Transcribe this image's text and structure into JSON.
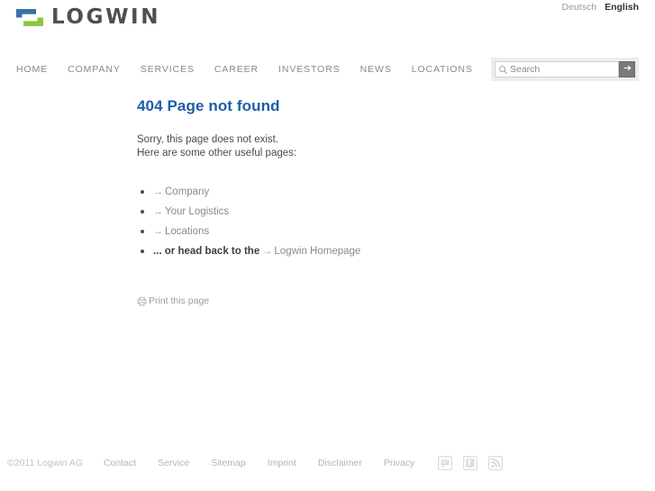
{
  "header": {
    "logo_text": "LOGWIN",
    "logo_icon": "logwin-logo-mark",
    "languages": [
      {
        "label": "Deutsch",
        "active": false
      },
      {
        "label": "English",
        "active": true
      }
    ]
  },
  "nav": {
    "items": [
      {
        "label": "HOME"
      },
      {
        "label": "COMPANY"
      },
      {
        "label": "SERVICES"
      },
      {
        "label": "CAREER"
      },
      {
        "label": "INVESTORS"
      },
      {
        "label": "NEWS"
      },
      {
        "label": "LOCATIONS"
      }
    ]
  },
  "search": {
    "placeholder": "Search",
    "value": "",
    "icon": "search-icon",
    "submit_icon": "arrow-right-icon"
  },
  "main": {
    "title": "404 Page not found",
    "line1": "Sorry, this page does not exist.",
    "line2": "Here are some other useful pages:",
    "links": [
      {
        "arrow": "→",
        "label": "Company",
        "prefix": ""
      },
      {
        "arrow": "→",
        "label": "Your Logistics",
        "prefix": ""
      },
      {
        "arrow": "→",
        "label": "Locations",
        "prefix": ""
      },
      {
        "arrow": "→",
        "label": "Logwin Homepage",
        "prefix": "... or head back to the"
      }
    ],
    "print_label": "Print this page",
    "print_icon": "printer-icon"
  },
  "footer": {
    "copyright": "©2011 Logwin AG",
    "links": [
      {
        "label": "Contact"
      },
      {
        "label": "Service"
      },
      {
        "label": "Sitemap"
      },
      {
        "label": "Imprint"
      },
      {
        "label": "Disclaimer"
      },
      {
        "label": "Privacy"
      }
    ],
    "social": [
      {
        "icon": "blog-comment-icon"
      },
      {
        "icon": "twitter-icon"
      },
      {
        "icon": "rss-icon"
      }
    ]
  },
  "colors": {
    "title_blue": "#1f5ea8",
    "logo_blue": "#3a6fa8",
    "logo_green": "#8dc63f",
    "nav_gray": "#8a8a8a",
    "footer_gray": "#b4b4b4",
    "search_btn": "#7a7a7a"
  }
}
